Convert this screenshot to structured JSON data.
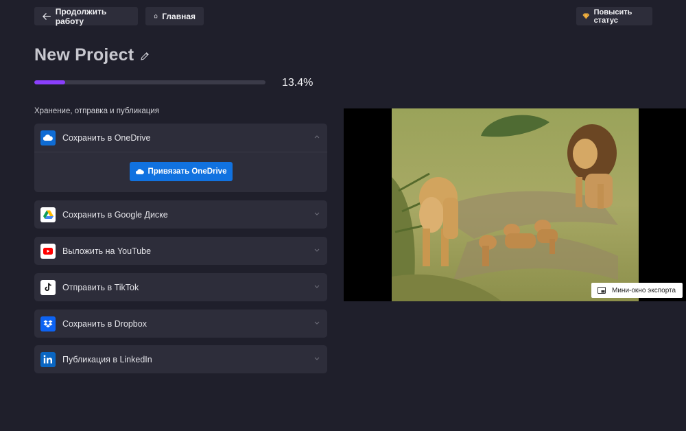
{
  "topbar": {
    "continue_label": "Продолжить работу",
    "home_label": "Главная",
    "upgrade_label": "Повысить статус"
  },
  "project": {
    "title": "New Project",
    "progress_text": "13.4%",
    "progress_value": 0.134
  },
  "section": {
    "label": "Хранение, отправка и публикация"
  },
  "destinations": [
    {
      "label": "Сохранить в OneDrive",
      "icon": "onedrive-icon",
      "expanded": true,
      "action_label": "Привязать OneDrive"
    },
    {
      "label": "Сохранить в Google Диске",
      "icon": "google-drive-icon"
    },
    {
      "label": "Выложить на YouTube",
      "icon": "youtube-icon"
    },
    {
      "label": "Отправить в TikTok",
      "icon": "tiktok-icon"
    },
    {
      "label": "Сохранить в Dropbox",
      "icon": "dropbox-icon"
    },
    {
      "label": "Публикация в LinkedIn",
      "icon": "linkedin-icon"
    }
  ],
  "preview": {
    "mini_window_label": "Мини-окно экспорта"
  },
  "colors": {
    "background": "#1f1f2b",
    "card": "#2d2d3a",
    "accent_progress": "#8a3ffc",
    "onedrive_button": "#1172e0"
  }
}
